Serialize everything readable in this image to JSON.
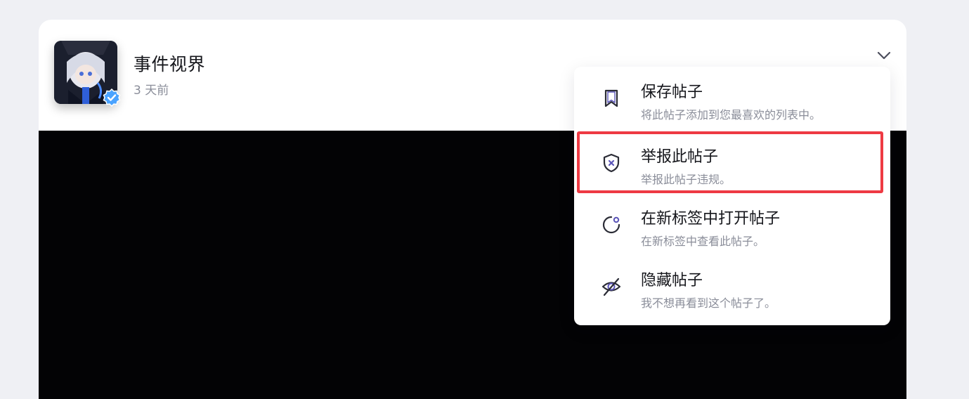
{
  "post": {
    "author": "事件视界",
    "time": "3 天前",
    "verified": true
  },
  "icons": {
    "avatar": "avatar-image",
    "verified": "verified-badge-icon",
    "expand": "chevron-down-icon"
  },
  "menu": {
    "items": [
      {
        "title": "保存帖子",
        "desc": "将此帖子添加到您最喜欢的列表中。",
        "icon": "bookmark-icon"
      },
      {
        "title": "举报此帖子",
        "desc": "举报此帖子违规。",
        "icon": "shield-x-icon",
        "highlighted": true
      },
      {
        "title": "在新标签中打开帖子",
        "desc": "在新标签中查看此帖子。",
        "icon": "open-tab-icon"
      },
      {
        "title": "隐藏帖子",
        "desc": "我不想再看到这个帖子了。",
        "icon": "eye-off-icon"
      }
    ]
  },
  "colors": {
    "background": "#eff0f4",
    "card": "#ffffff",
    "media": "#030305",
    "accent": "#5b55b8",
    "highlight_border": "#ee3a43",
    "verified": "#4aa3ff"
  }
}
